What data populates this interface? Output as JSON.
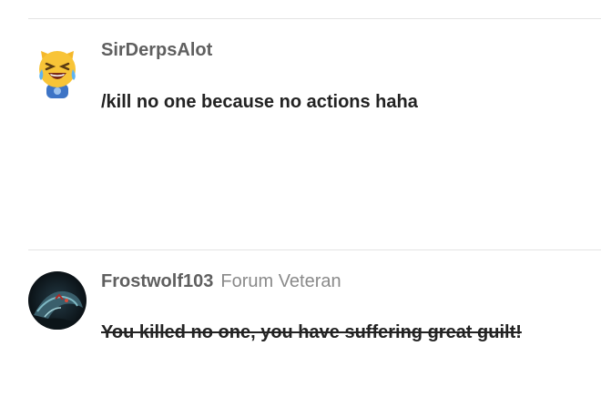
{
  "posts": [
    {
      "username": "SirDerpsAlot",
      "rank": "",
      "message": "/kill no one because no actions haha",
      "avatar_icon": "laughing-crying-emoji-icon"
    },
    {
      "username": "Frostwolf103",
      "rank": "Forum Veteran",
      "message": "You killed no one, you have suffering great guilt!",
      "avatar_icon": "dark-creature-avatar",
      "message_strikethrough": true
    }
  ],
  "colors": {
    "username": "#5f5f5f",
    "rank": "#8a8a8a",
    "message": "#222222",
    "divider": "#e4e4e4"
  }
}
